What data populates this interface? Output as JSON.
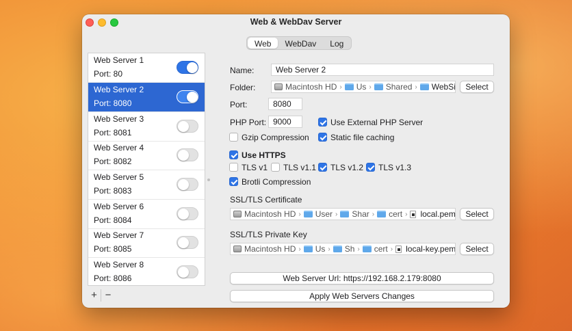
{
  "window": {
    "title": "Web & WebDav Server"
  },
  "tabs": [
    {
      "label": "Web"
    },
    {
      "label": "WebDav"
    },
    {
      "label": "Log"
    }
  ],
  "servers": [
    {
      "name": "Web Server 1",
      "port": "Port: 80",
      "enabled": true
    },
    {
      "name": "Web Server 2",
      "port": "Port: 8080",
      "enabled": true
    },
    {
      "name": "Web Server 3",
      "port": "Port: 8081",
      "enabled": false
    },
    {
      "name": "Web Server 4",
      "port": "Port: 8082",
      "enabled": false
    },
    {
      "name": "Web Server 5",
      "port": "Port: 8083",
      "enabled": false
    },
    {
      "name": "Web Server 6",
      "port": "Port: 8084",
      "enabled": false
    },
    {
      "name": "Web Server 7",
      "port": "Port: 8085",
      "enabled": false
    },
    {
      "name": "Web Server 8",
      "port": "Port: 8086",
      "enabled": false
    }
  ],
  "list_buttons": {
    "add": "+",
    "remove": "−"
  },
  "form": {
    "name_label": "Name:",
    "name_value": "Web Server 2",
    "folder_label": "Folder:",
    "folder_path": [
      "Macintosh HD",
      "Us",
      "Shared",
      "WebSite"
    ],
    "select_label": "Select",
    "port_label": "Port:",
    "port_value": "8080",
    "php_port_label": "PHP Port:",
    "php_port_value": "9000",
    "use_external_php": {
      "label": "Use External PHP Server",
      "checked": true
    },
    "gzip": {
      "label": "Gzip Compression",
      "checked": false
    },
    "static_caching": {
      "label": "Static file caching",
      "checked": true
    },
    "use_https": {
      "label": "Use HTTPS",
      "checked": true
    },
    "tls_v1": {
      "label": "TLS v1",
      "checked": false
    },
    "tls_v11": {
      "label": "TLS v1.1",
      "checked": false
    },
    "tls_v12": {
      "label": "TLS v1.2",
      "checked": true
    },
    "tls_v13": {
      "label": "TLS v1.3",
      "checked": true
    },
    "brotli": {
      "label": "Brotli Compression",
      "checked": true
    },
    "cert_label": "SSL/TLS Certificate",
    "cert_path": [
      "Macintosh HD",
      "User",
      "Shar",
      "cert",
      "local.pem"
    ],
    "key_label": "SSL/TLS Private Key",
    "key_path": [
      "Macintosh HD",
      "Us",
      "Sh",
      "cert",
      "local-key.pem"
    ],
    "server_url_button": "Web Server Url: https://192.168.2.179:8080",
    "apply_button": "Apply Web Servers Changes"
  },
  "colors": {
    "accent": "#2e74e6",
    "selection": "#2d67d2"
  }
}
